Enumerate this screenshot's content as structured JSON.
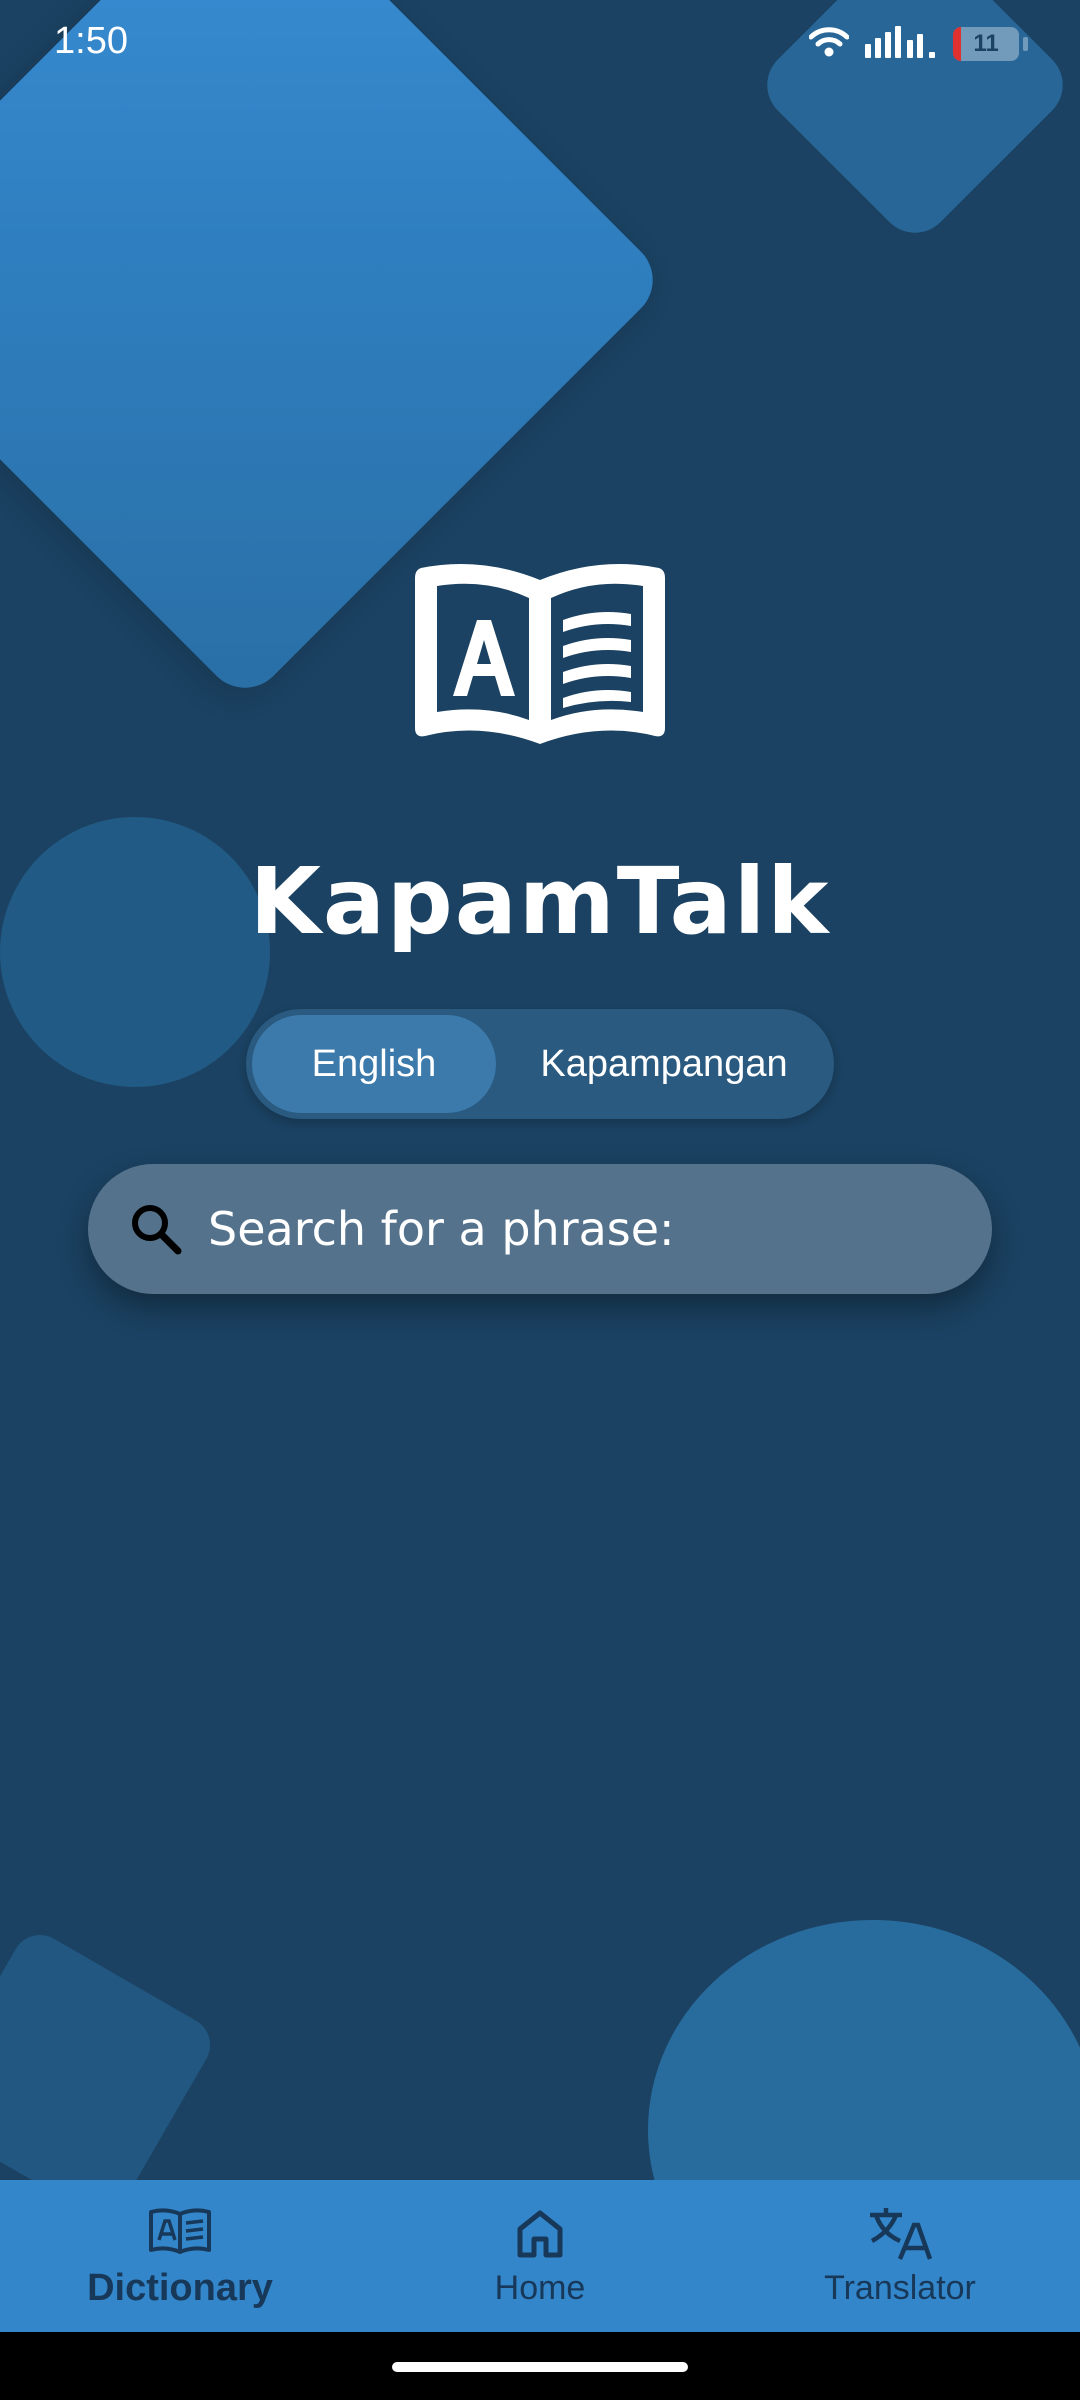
{
  "status_bar": {
    "time": "1:50",
    "battery_level": "11",
    "icons": [
      "wifi-icon",
      "signal-icon",
      "battery-icon"
    ]
  },
  "app": {
    "title": "KapamTalk",
    "logo_icon": "open-book-icon"
  },
  "language_toggle": {
    "options": [
      {
        "label": "English",
        "selected": true
      },
      {
        "label": "Kapampangan",
        "selected": false
      }
    ]
  },
  "search": {
    "placeholder": "Search for a phrase:",
    "value": "",
    "icon": "search-icon"
  },
  "bottom_nav": {
    "items": [
      {
        "label": "Dictionary",
        "icon": "dictionary-icon",
        "active": true
      },
      {
        "label": "Home",
        "icon": "home-icon",
        "active": false
      },
      {
        "label": "Translator",
        "icon": "translate-icon",
        "active": false
      }
    ]
  },
  "colors": {
    "background": "#1b4262",
    "accent": "#3386c9",
    "nav_text": "#18385a",
    "battery_low": "#e03030"
  }
}
